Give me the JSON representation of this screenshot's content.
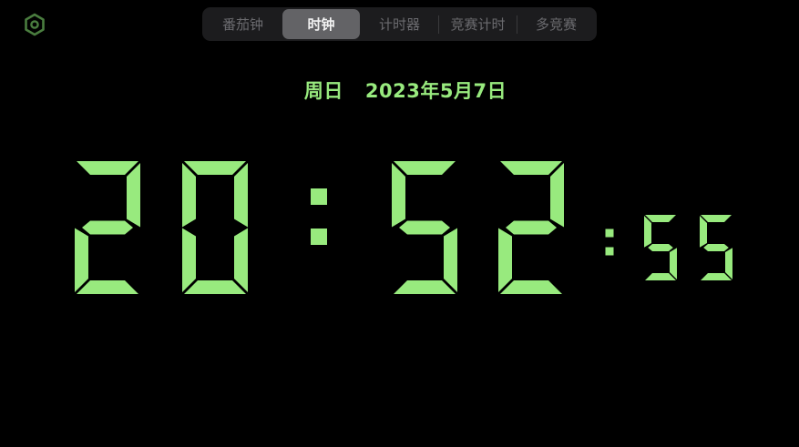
{
  "tabs": [
    {
      "label": "番茄钟",
      "active": false
    },
    {
      "label": "时钟",
      "active": true
    },
    {
      "label": "计时器",
      "active": false
    },
    {
      "label": "竞赛计时",
      "active": false
    },
    {
      "label": "多竞赛",
      "active": false
    }
  ],
  "date": {
    "weekday": "周日",
    "full": "2023年5月7日"
  },
  "time": {
    "hours": "20",
    "minutes": "52",
    "seconds": "55"
  },
  "icons": {
    "settings": "settings-hexagon-icon"
  },
  "colors": {
    "background": "#000000",
    "digit": "#98ea7e",
    "icon": "#4a7d3f",
    "segment_bg": "#1c1c1e",
    "segment_active": "#636366"
  }
}
